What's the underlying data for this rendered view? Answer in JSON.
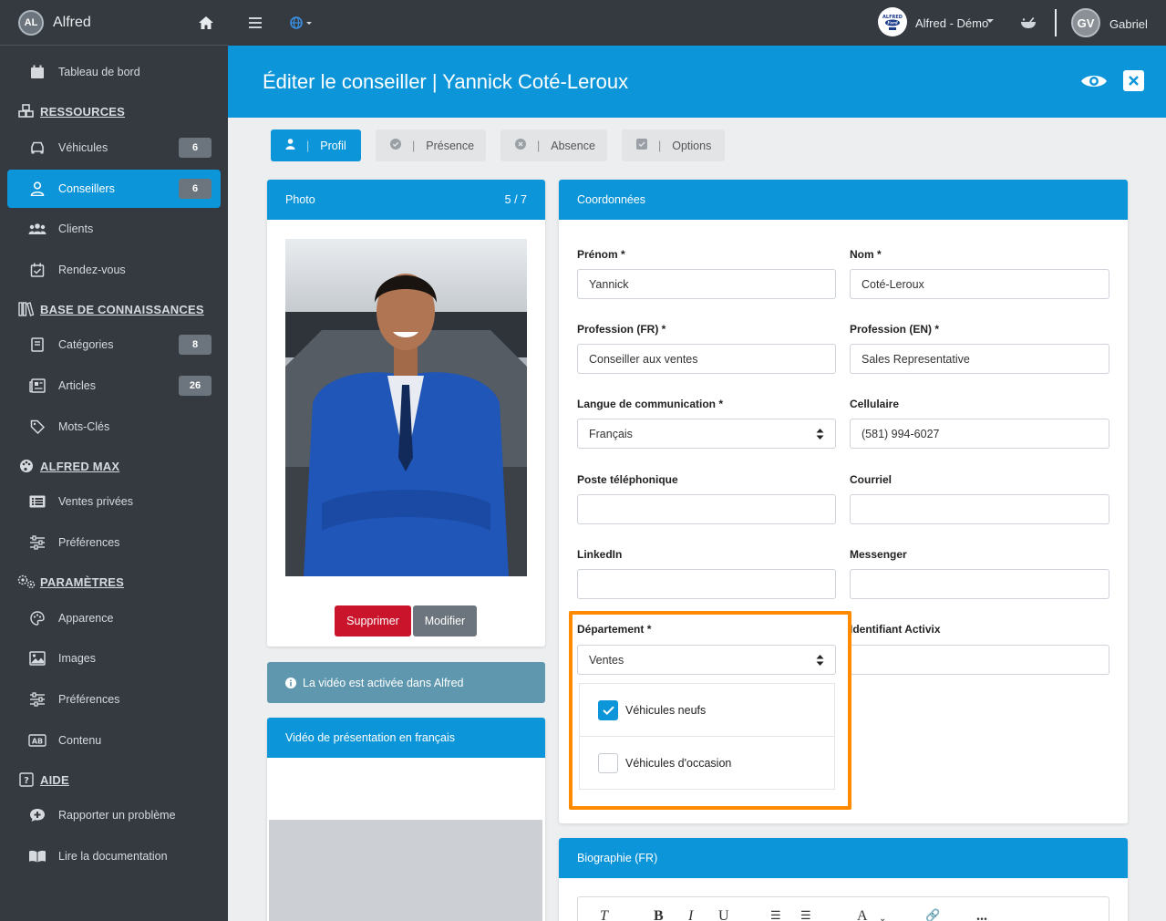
{
  "brand": {
    "logo_text": "AL",
    "name": "Alfred"
  },
  "sidebar": {
    "items": [
      {
        "label": "Tableau de bord"
      },
      {
        "label": "Véhicules",
        "badge": "6"
      },
      {
        "label": "Conseillers",
        "badge": "6",
        "active": true
      },
      {
        "label": "Clients"
      },
      {
        "label": "Rendez-vous"
      },
      {
        "label": "Catégories",
        "badge": "8"
      },
      {
        "label": "Articles",
        "badge": "26"
      },
      {
        "label": "Mots-Clés"
      },
      {
        "label": "Ventes privées"
      },
      {
        "label": "Préférences"
      },
      {
        "label": "Apparence"
      },
      {
        "label": "Images"
      },
      {
        "label": "Préférences"
      },
      {
        "label": "Contenu"
      },
      {
        "label": "Rapporter un problème"
      },
      {
        "label": "Lire la documentation"
      }
    ],
    "sections": [
      {
        "label": "RESSOURCES"
      },
      {
        "label": "BASE DE CONNAISSANCES"
      },
      {
        "label": "ALFRED MAX"
      },
      {
        "label": "PARAMÈTRES"
      },
      {
        "label": "AIDE"
      }
    ]
  },
  "topbar": {
    "dealer_logo_text": "ALFRED Ford",
    "dealer_name": "Alfred - Démo",
    "user_initials": "GV",
    "user_name": "Gabriel"
  },
  "header": {
    "title": "Éditer le conseiller | Yannick Coté-Leroux"
  },
  "tabs": [
    {
      "label": "Profil",
      "active": true
    },
    {
      "label": "Présence"
    },
    {
      "label": "Absence"
    },
    {
      "label": "Options"
    }
  ],
  "photo_card": {
    "title": "Photo",
    "counter": "5 / 7",
    "delete_label": "Supprimer",
    "edit_label": "Modifier"
  },
  "video_info": "La vidéo est activée dans Alfred",
  "video_card": {
    "title": "Vidéo de présentation en français"
  },
  "coords": {
    "title": "Coordonnées",
    "fields": {
      "prenom": {
        "label": "Prénom *",
        "value": "Yannick"
      },
      "nom": {
        "label": "Nom *",
        "value": "Coté-Leroux"
      },
      "profession_fr": {
        "label": "Profession (FR) *",
        "value": "Conseiller aux ventes"
      },
      "profession_en": {
        "label": "Profession (EN) *",
        "value": "Sales Representative"
      },
      "langue": {
        "label": "Langue de communication *",
        "value": "Français"
      },
      "cellulaire": {
        "label": "Cellulaire",
        "value": "(581) 994-6027"
      },
      "poste": {
        "label": "Poste téléphonique",
        "value": ""
      },
      "courriel": {
        "label": "Courriel",
        "value": ""
      },
      "linkedin": {
        "label": "LinkedIn",
        "value": ""
      },
      "messenger": {
        "label": "Messenger",
        "value": ""
      },
      "departement": {
        "label": "Département *",
        "value": "Ventes"
      },
      "activix": {
        "label": "Identifiant Activix",
        "value": ""
      }
    },
    "checkboxes": [
      {
        "label": "Véhicules neufs",
        "checked": true
      },
      {
        "label": "Véhicules d'occasion",
        "checked": false
      }
    ]
  },
  "bio_card": {
    "title": "Biographie (FR)"
  },
  "editor_toolbar": [
    "T",
    "B",
    "I",
    "U",
    "A",
    "..."
  ],
  "colors": {
    "primary": "#0c95d9",
    "sidebar": "#343a40",
    "danger": "#c9142b",
    "secondary": "#6c757d",
    "highlight": "#ff8a00"
  }
}
